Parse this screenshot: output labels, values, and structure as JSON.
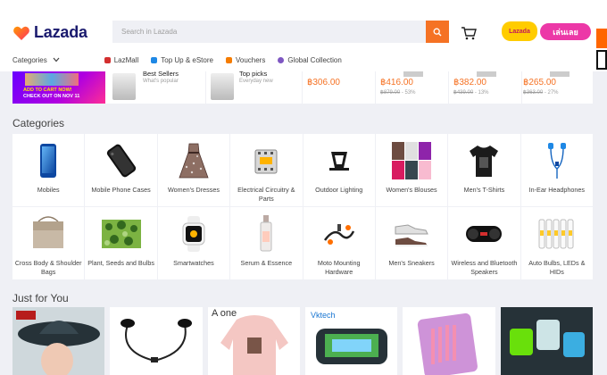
{
  "brand": {
    "name": "Lazada",
    "color": "#f57224",
    "navy": "#1a1a6e"
  },
  "search": {
    "placeholder": "Search in Lazada"
  },
  "promo": {
    "badge_text": "Lazada",
    "button_label": "เล่นเลย"
  },
  "nav": {
    "categories_label": "Categories",
    "items": [
      {
        "label": "LazMall",
        "color": "#d32f2f"
      },
      {
        "label": "Top Up & eStore",
        "color": "#1e88e5"
      },
      {
        "label": "Vouchers",
        "color": "#f57c00"
      },
      {
        "label": "Global Collection",
        "color": "#7e57c2"
      }
    ]
  },
  "strip": {
    "banner": {
      "line1": "ADD TO CART NOW!",
      "line2": "CHECK OUT ON NOV 11"
    },
    "best_sellers": {
      "title": "Best Sellers",
      "subtitle": "What's popular"
    },
    "top_picks": {
      "title": "Top picks",
      "subtitle": "Everyday new"
    },
    "deals": [
      {
        "price": "฿306.00",
        "original": "",
        "discount": ""
      },
      {
        "price": "฿416.00",
        "original": "฿879.00",
        "discount": "- 53%"
      },
      {
        "price": "฿382.00",
        "original": "฿439.00",
        "discount": "- 13%"
      },
      {
        "price": "฿265.00",
        "original": "฿363.00",
        "discount": "- 27%"
      }
    ]
  },
  "categories": {
    "title": "Categories",
    "items": [
      {
        "label": "Mobiles",
        "icon": "mobile-phone"
      },
      {
        "label": "Mobile Phone Cases",
        "icon": "phone-case"
      },
      {
        "label": "Women's Dresses",
        "icon": "dress"
      },
      {
        "label": "Electrical Circuitry & Parts",
        "icon": "circuit-breaker"
      },
      {
        "label": "Outdoor Lighting",
        "icon": "outdoor-lamp"
      },
      {
        "label": "Women's Blouses",
        "icon": "blouse"
      },
      {
        "label": "Men's T-Shirts",
        "icon": "tshirt"
      },
      {
        "label": "In-Ear Headphones",
        "icon": "earphones"
      },
      {
        "label": "Cross Body & Shoulder Bags",
        "icon": "bag"
      },
      {
        "label": "Plant, Seeds and Bulbs",
        "icon": "plant"
      },
      {
        "label": "Smartwatches",
        "icon": "smartwatch"
      },
      {
        "label": "Serum & Essence",
        "icon": "serum-bottle"
      },
      {
        "label": "Moto Mounting Hardware",
        "icon": "moto-mount"
      },
      {
        "label": "Men's Sneakers",
        "icon": "sneaker"
      },
      {
        "label": "Wireless and Bluetooth Speakers",
        "icon": "speaker"
      },
      {
        "label": "Auto Bulbs, LEDs & HIDs",
        "icon": "auto-bulb"
      }
    ]
  },
  "just_for_you": {
    "title": "Just for You",
    "cards": [
      {
        "icon": "hat-photo"
      },
      {
        "icon": "earphones-photo"
      },
      {
        "icon": "hoodie-photo",
        "caption": "A one"
      },
      {
        "icon": "game-controller-photo",
        "caption": "Vktech"
      },
      {
        "icon": "makeup-brush-photo"
      },
      {
        "icon": "lamp-speaker-photo"
      }
    ]
  }
}
